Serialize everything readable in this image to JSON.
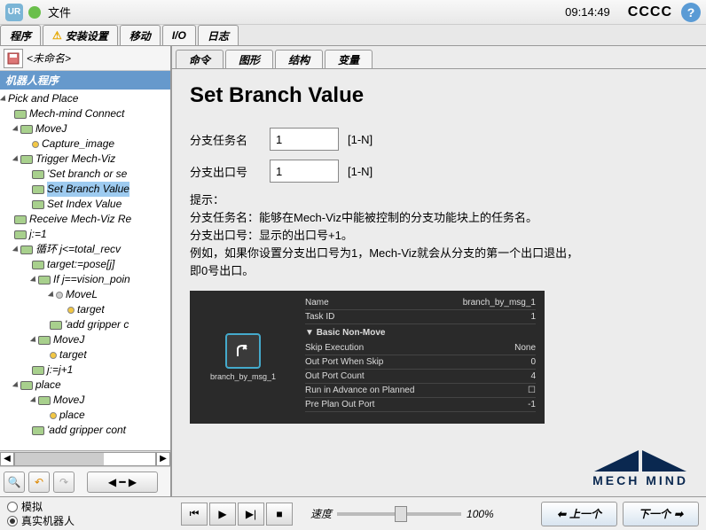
{
  "titlebar": {
    "logo": "UR",
    "file": "文件",
    "clock": "09:14:49",
    "cccc": "CCCC"
  },
  "maintabs": [
    "程序",
    "安装设置",
    "移动",
    "I/O",
    "日志"
  ],
  "left": {
    "unnamed": "<未命名>",
    "treehdr": "机器人程序",
    "nodes": {
      "n0": "Pick and Place",
      "n1": "Mech-mind Connect",
      "n2": "MoveJ",
      "n3": "Capture_image",
      "n4": "Trigger Mech-Viz",
      "n5": "'Set branch or se",
      "n6": "Set Branch Value",
      "n7": "Set Index Value",
      "n8": "Receive Mech-Viz Re",
      "n9": "j:=1",
      "n10": "循环 j<=total_recv",
      "n11": "target:=pose[j]",
      "n12": "If j==vision_poin",
      "n13": "MoveL",
      "n14": "target",
      "n15": "'add gripper c",
      "n16": "MoveJ",
      "n17": "target",
      "n18": "j:=j+1",
      "n19": "place",
      "n20": "MoveJ",
      "n21": "place",
      "n22": "'add gripper cont"
    }
  },
  "subtabs": [
    "命令",
    "图形",
    "结构",
    "变量"
  ],
  "content": {
    "title": "Set Branch Value",
    "row1_label": "分支任务名",
    "row1_val": "1",
    "row1_range": "[1-N]",
    "row2_label": "分支出口号",
    "row2_val": "1",
    "row2_range": "[1-N]",
    "hint_h": "提示：",
    "hint_1": "分支任务名：能够在Mech-Viz中能被控制的分支功能块上的任务名。",
    "hint_2": "分支出口号：显示的出口号+1。",
    "hint_3": "例如，如果你设置分支出口号为1，Mech-Viz就会从分支的第一个出口退出，",
    "hint_4": "即0号出口。"
  },
  "props": {
    "node_caption": "branch_by_msg_1",
    "r0k": "Name",
    "r0v": "branch_by_msg_1",
    "r1k": "Task ID",
    "r1v": "1",
    "sect": "Basic Non-Move",
    "r2k": "Skip Execution",
    "r2v": "None",
    "r3k": "Out Port When Skip",
    "r3v": "0",
    "r4k": "Out Port Count",
    "r4v": "4",
    "r5k": "Run in Advance on Planned",
    "r5v": "☐",
    "r6k": "Pre Plan Out Port",
    "r6v": "-1"
  },
  "logo_text": "MECH MIND",
  "bottom": {
    "sim": "模拟",
    "real": "真实机器人",
    "speed_label": "速度",
    "speed_val": "100%",
    "prev": "上一个",
    "next": "下一个"
  }
}
